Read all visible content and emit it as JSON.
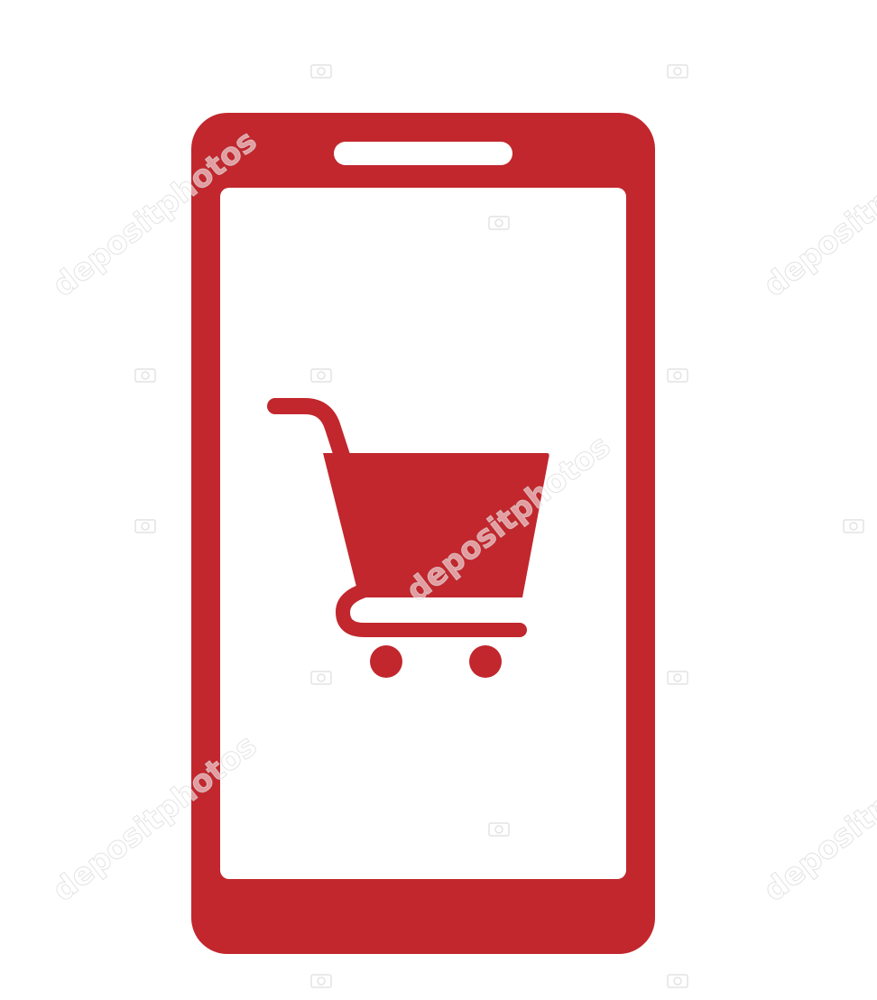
{
  "watermark": {
    "text": "depositphotos"
  },
  "colors": {
    "brand_red": "#c1272d",
    "background": "#ffffff",
    "screen": "#ffffff"
  },
  "icons": {
    "device": "smartphone-icon",
    "screen_content": "shopping-cart-icon"
  }
}
